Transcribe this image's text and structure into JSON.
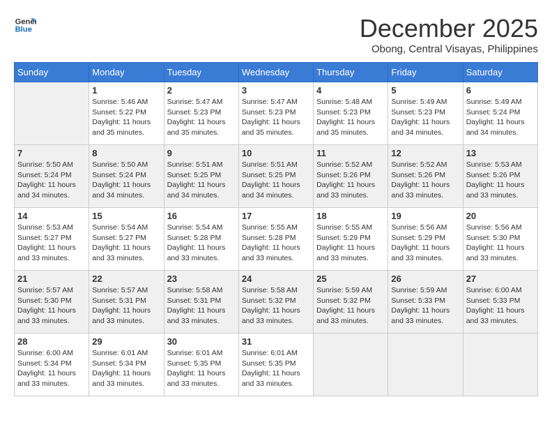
{
  "header": {
    "logo_line1": "General",
    "logo_line2": "Blue",
    "month_year": "December 2025",
    "location": "Obong, Central Visayas, Philippines"
  },
  "weekdays": [
    "Sunday",
    "Monday",
    "Tuesday",
    "Wednesday",
    "Thursday",
    "Friday",
    "Saturday"
  ],
  "weeks": [
    [
      {
        "day": "",
        "info": ""
      },
      {
        "day": "1",
        "info": "Sunrise: 5:46 AM\nSunset: 5:22 PM\nDaylight: 11 hours\nand 35 minutes."
      },
      {
        "day": "2",
        "info": "Sunrise: 5:47 AM\nSunset: 5:23 PM\nDaylight: 11 hours\nand 35 minutes."
      },
      {
        "day": "3",
        "info": "Sunrise: 5:47 AM\nSunset: 5:23 PM\nDaylight: 11 hours\nand 35 minutes."
      },
      {
        "day": "4",
        "info": "Sunrise: 5:48 AM\nSunset: 5:23 PM\nDaylight: 11 hours\nand 35 minutes."
      },
      {
        "day": "5",
        "info": "Sunrise: 5:49 AM\nSunset: 5:23 PM\nDaylight: 11 hours\nand 34 minutes."
      },
      {
        "day": "6",
        "info": "Sunrise: 5:49 AM\nSunset: 5:24 PM\nDaylight: 11 hours\nand 34 minutes."
      }
    ],
    [
      {
        "day": "7",
        "info": "Sunrise: 5:50 AM\nSunset: 5:24 PM\nDaylight: 11 hours\nand 34 minutes."
      },
      {
        "day": "8",
        "info": "Sunrise: 5:50 AM\nSunset: 5:24 PM\nDaylight: 11 hours\nand 34 minutes."
      },
      {
        "day": "9",
        "info": "Sunrise: 5:51 AM\nSunset: 5:25 PM\nDaylight: 11 hours\nand 34 minutes."
      },
      {
        "day": "10",
        "info": "Sunrise: 5:51 AM\nSunset: 5:25 PM\nDaylight: 11 hours\nand 34 minutes."
      },
      {
        "day": "11",
        "info": "Sunrise: 5:52 AM\nSunset: 5:26 PM\nDaylight: 11 hours\nand 33 minutes."
      },
      {
        "day": "12",
        "info": "Sunrise: 5:52 AM\nSunset: 5:26 PM\nDaylight: 11 hours\nand 33 minutes."
      },
      {
        "day": "13",
        "info": "Sunrise: 5:53 AM\nSunset: 5:26 PM\nDaylight: 11 hours\nand 33 minutes."
      }
    ],
    [
      {
        "day": "14",
        "info": "Sunrise: 5:53 AM\nSunset: 5:27 PM\nDaylight: 11 hours\nand 33 minutes."
      },
      {
        "day": "15",
        "info": "Sunrise: 5:54 AM\nSunset: 5:27 PM\nDaylight: 11 hours\nand 33 minutes."
      },
      {
        "day": "16",
        "info": "Sunrise: 5:54 AM\nSunset: 5:28 PM\nDaylight: 11 hours\nand 33 minutes."
      },
      {
        "day": "17",
        "info": "Sunrise: 5:55 AM\nSunset: 5:28 PM\nDaylight: 11 hours\nand 33 minutes."
      },
      {
        "day": "18",
        "info": "Sunrise: 5:55 AM\nSunset: 5:29 PM\nDaylight: 11 hours\nand 33 minutes."
      },
      {
        "day": "19",
        "info": "Sunrise: 5:56 AM\nSunset: 5:29 PM\nDaylight: 11 hours\nand 33 minutes."
      },
      {
        "day": "20",
        "info": "Sunrise: 5:56 AM\nSunset: 5:30 PM\nDaylight: 11 hours\nand 33 minutes."
      }
    ],
    [
      {
        "day": "21",
        "info": "Sunrise: 5:57 AM\nSunset: 5:30 PM\nDaylight: 11 hours\nand 33 minutes."
      },
      {
        "day": "22",
        "info": "Sunrise: 5:57 AM\nSunset: 5:31 PM\nDaylight: 11 hours\nand 33 minutes."
      },
      {
        "day": "23",
        "info": "Sunrise: 5:58 AM\nSunset: 5:31 PM\nDaylight: 11 hours\nand 33 minutes."
      },
      {
        "day": "24",
        "info": "Sunrise: 5:58 AM\nSunset: 5:32 PM\nDaylight: 11 hours\nand 33 minutes."
      },
      {
        "day": "25",
        "info": "Sunrise: 5:59 AM\nSunset: 5:32 PM\nDaylight: 11 hours\nand 33 minutes."
      },
      {
        "day": "26",
        "info": "Sunrise: 5:59 AM\nSunset: 5:33 PM\nDaylight: 11 hours\nand 33 minutes."
      },
      {
        "day": "27",
        "info": "Sunrise: 6:00 AM\nSunset: 5:33 PM\nDaylight: 11 hours\nand 33 minutes."
      }
    ],
    [
      {
        "day": "28",
        "info": "Sunrise: 6:00 AM\nSunset: 5:34 PM\nDaylight: 11 hours\nand 33 minutes."
      },
      {
        "day": "29",
        "info": "Sunrise: 6:01 AM\nSunset: 5:34 PM\nDaylight: 11 hours\nand 33 minutes."
      },
      {
        "day": "30",
        "info": "Sunrise: 6:01 AM\nSunset: 5:35 PM\nDaylight: 11 hours\nand 33 minutes."
      },
      {
        "day": "31",
        "info": "Sunrise: 6:01 AM\nSunset: 5:35 PM\nDaylight: 11 hours\nand 33 minutes."
      },
      {
        "day": "",
        "info": ""
      },
      {
        "day": "",
        "info": ""
      },
      {
        "day": "",
        "info": ""
      }
    ]
  ]
}
